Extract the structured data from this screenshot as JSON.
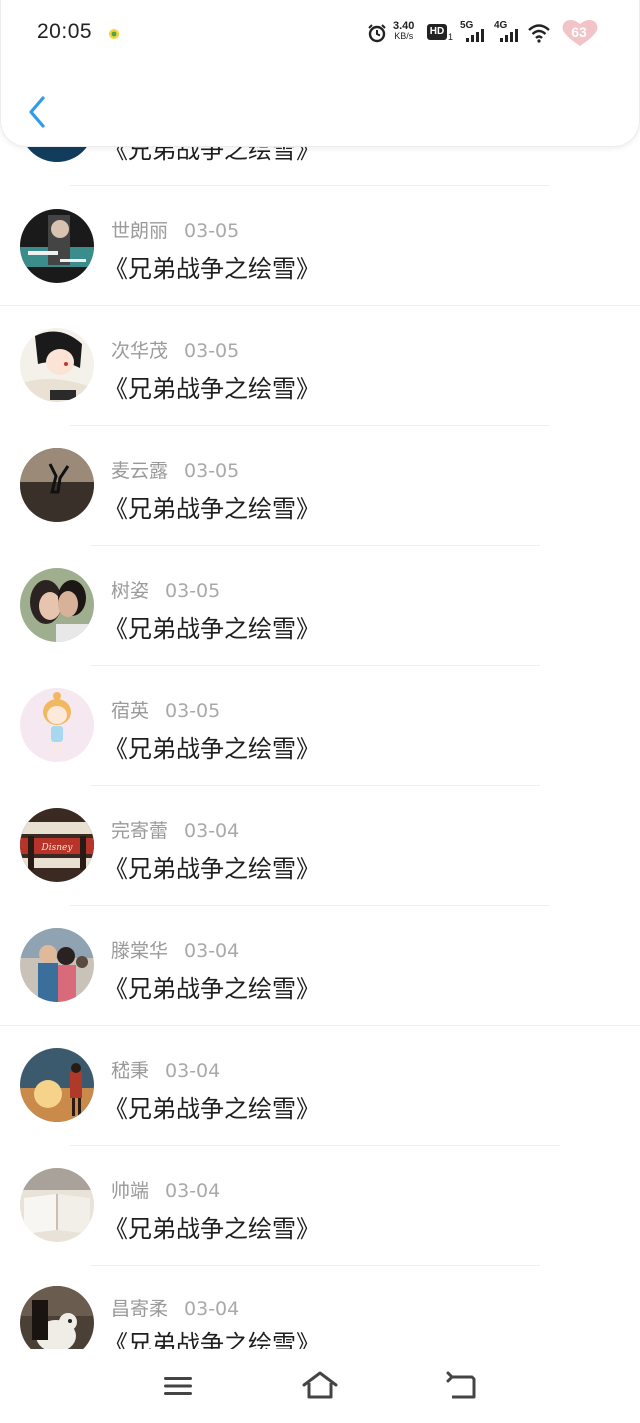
{
  "status_bar": {
    "time": "20:05",
    "net_speed_value": "3.40",
    "net_speed_unit": "KB/s",
    "hd_label": "HD",
    "hd_sub": "1",
    "signal_5g": "5G",
    "signal_4g": "4G",
    "battery": "63"
  },
  "header": {
    "back_icon": "chevron-left-icon"
  },
  "comments": [
    {
      "name": "",
      "date": "",
      "text": "《兄弟战争之绘雪》",
      "avatar": "blue-sphere"
    },
    {
      "name": "世朗丽",
      "date": "03-05",
      "text": "《兄弟战争之绘雪》",
      "avatar": "couple-dark"
    },
    {
      "name": "次华茂",
      "date": "03-05",
      "text": "《兄弟战争之绘雪》",
      "avatar": "manga-girl"
    },
    {
      "name": "麦云露",
      "date": "03-05",
      "text": "《兄弟战争之绘雪》",
      "avatar": "beach-jump"
    },
    {
      "name": "树姿",
      "date": "03-05",
      "text": "《兄弟战争之绘雪》",
      "avatar": "kiss-couple"
    },
    {
      "name": "宿英",
      "date": "03-05",
      "text": "《兄弟战争之绘雪》",
      "avatar": "cartoon-girl"
    },
    {
      "name": "完寄蕾",
      "date": "03-04",
      "text": "《兄弟战争之绘雪》",
      "avatar": "disney-sign"
    },
    {
      "name": "滕棠华",
      "date": "03-04",
      "text": "《兄弟战争之绘雪》",
      "avatar": "street-couple"
    },
    {
      "name": "嵇秉",
      "date": "03-04",
      "text": "《兄弟战争之绘雪》",
      "avatar": "sunset-boy"
    },
    {
      "name": "帅端",
      "date": "03-04",
      "text": "《兄弟战争之绘雪》",
      "avatar": "open-book"
    },
    {
      "name": "昌寄柔",
      "date": "03-04",
      "text": "《兄弟战争之绘雪》",
      "avatar": "dog-hug"
    }
  ],
  "nav_bar": {
    "menu_icon": "menu-icon",
    "home_icon": "home-icon",
    "back_icon": "return-icon"
  },
  "colors": {
    "accent": "#2f9bec",
    "battery": "#f2c4c8",
    "text_dark": "#1e1e1e",
    "text_muted": "#9a9a9a"
  }
}
